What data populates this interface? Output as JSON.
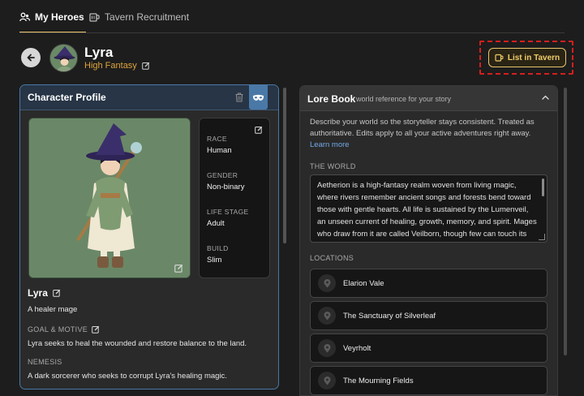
{
  "tabs": [
    {
      "label": "My Heroes",
      "icon": "users-icon",
      "active": true
    },
    {
      "label": "Tavern Recruitment",
      "icon": "mug-icon",
      "active": false
    }
  ],
  "header": {
    "hero_name": "Lyra",
    "genre": "High Fantasy",
    "list_button": "List in Tavern"
  },
  "profile": {
    "title": "Character Profile",
    "stats": [
      {
        "label": "RACE",
        "value": "Human"
      },
      {
        "label": "GENDER",
        "value": "Non-binary"
      },
      {
        "label": "LIFE STAGE",
        "value": "Adult"
      },
      {
        "label": "BUILD",
        "value": "Slim"
      }
    ],
    "name": "Lyra",
    "tagline": "A healer mage",
    "goal_label": "GOAL & MOTIVE",
    "goal_text": "Lyra seeks to heal the wounded and restore balance to the land.",
    "nemesis_label": "NEMESIS",
    "nemesis_text": "A dark sorcerer who seeks to corrupt Lyra's healing magic."
  },
  "lore": {
    "title": "Lore Book",
    "subtitle": "world reference for your story",
    "description": "Describe your world so the storyteller stays consistent. Treated as authoritative. Edits apply to all your active adventures right away.",
    "learn_more": "Learn more",
    "world_label": "THE WORLD",
    "world_text": "Aetherion is a high-fantasy realm woven from living magic, where rivers remember ancient songs and forests bend toward those with gentle hearts. All life is sustained by the Lumenveil, an unseen current of healing, growth, memory, and spirit. Mages who draw from it are called Veilborn, though few can touch its restorative power without being",
    "locations_label": "LOCATIONS",
    "locations": [
      "Elarion Vale",
      "The Sanctuary of Silverleaf",
      "Veyrholt",
      "The Mourning Fields"
    ]
  },
  "colors": {
    "accent_gold": "#e9c46a",
    "profile_border": "#4a79a7",
    "link": "#74a7e6",
    "highlight_dashed": "#d51f1f"
  }
}
